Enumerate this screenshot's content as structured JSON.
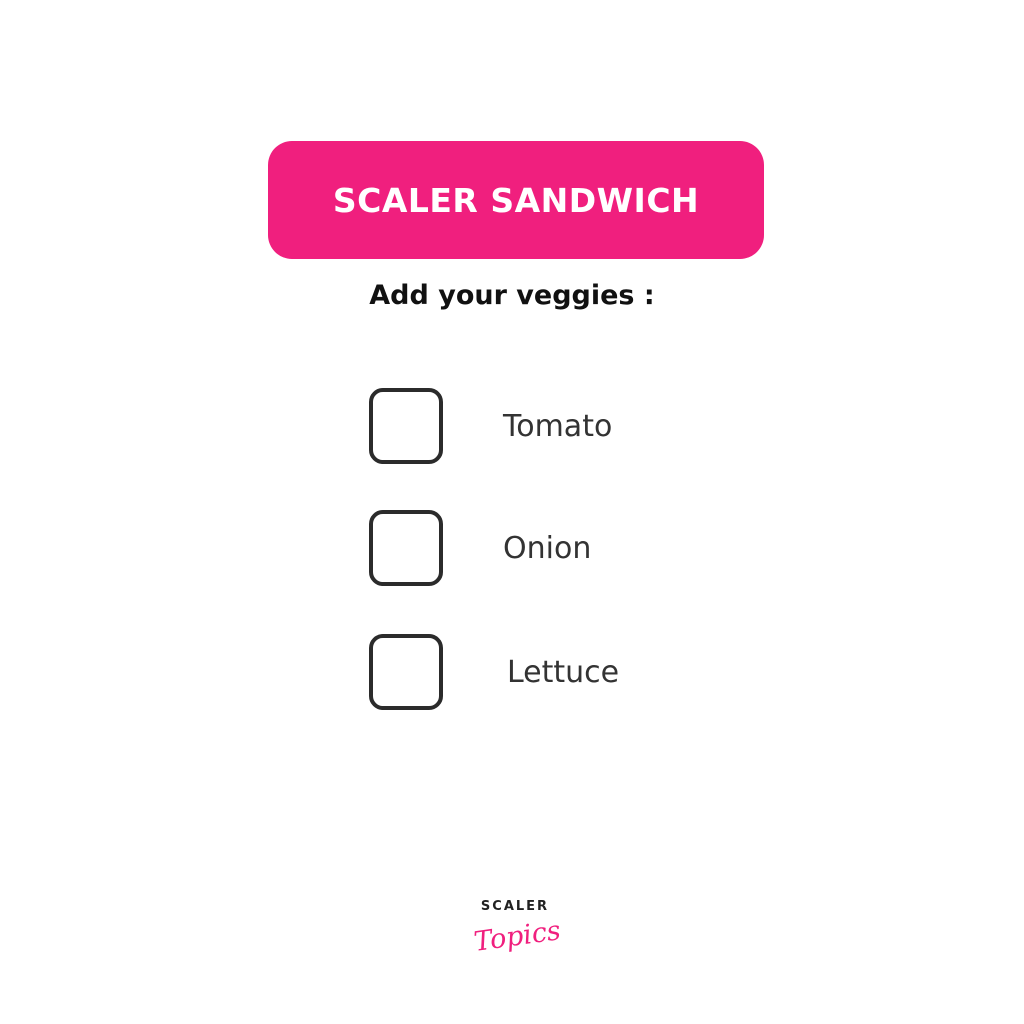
{
  "header": {
    "title": "SCALER SANDWICH",
    "accent_color": "#F01F7E"
  },
  "form": {
    "prompt": "Add your veggies :",
    "options": [
      {
        "label": "Tomato",
        "checked": false
      },
      {
        "label": "Onion",
        "checked": false
      },
      {
        "label": "Lettuce",
        "checked": false
      }
    ]
  },
  "logo": {
    "wordmark": "SCALER",
    "script": "Topics"
  }
}
